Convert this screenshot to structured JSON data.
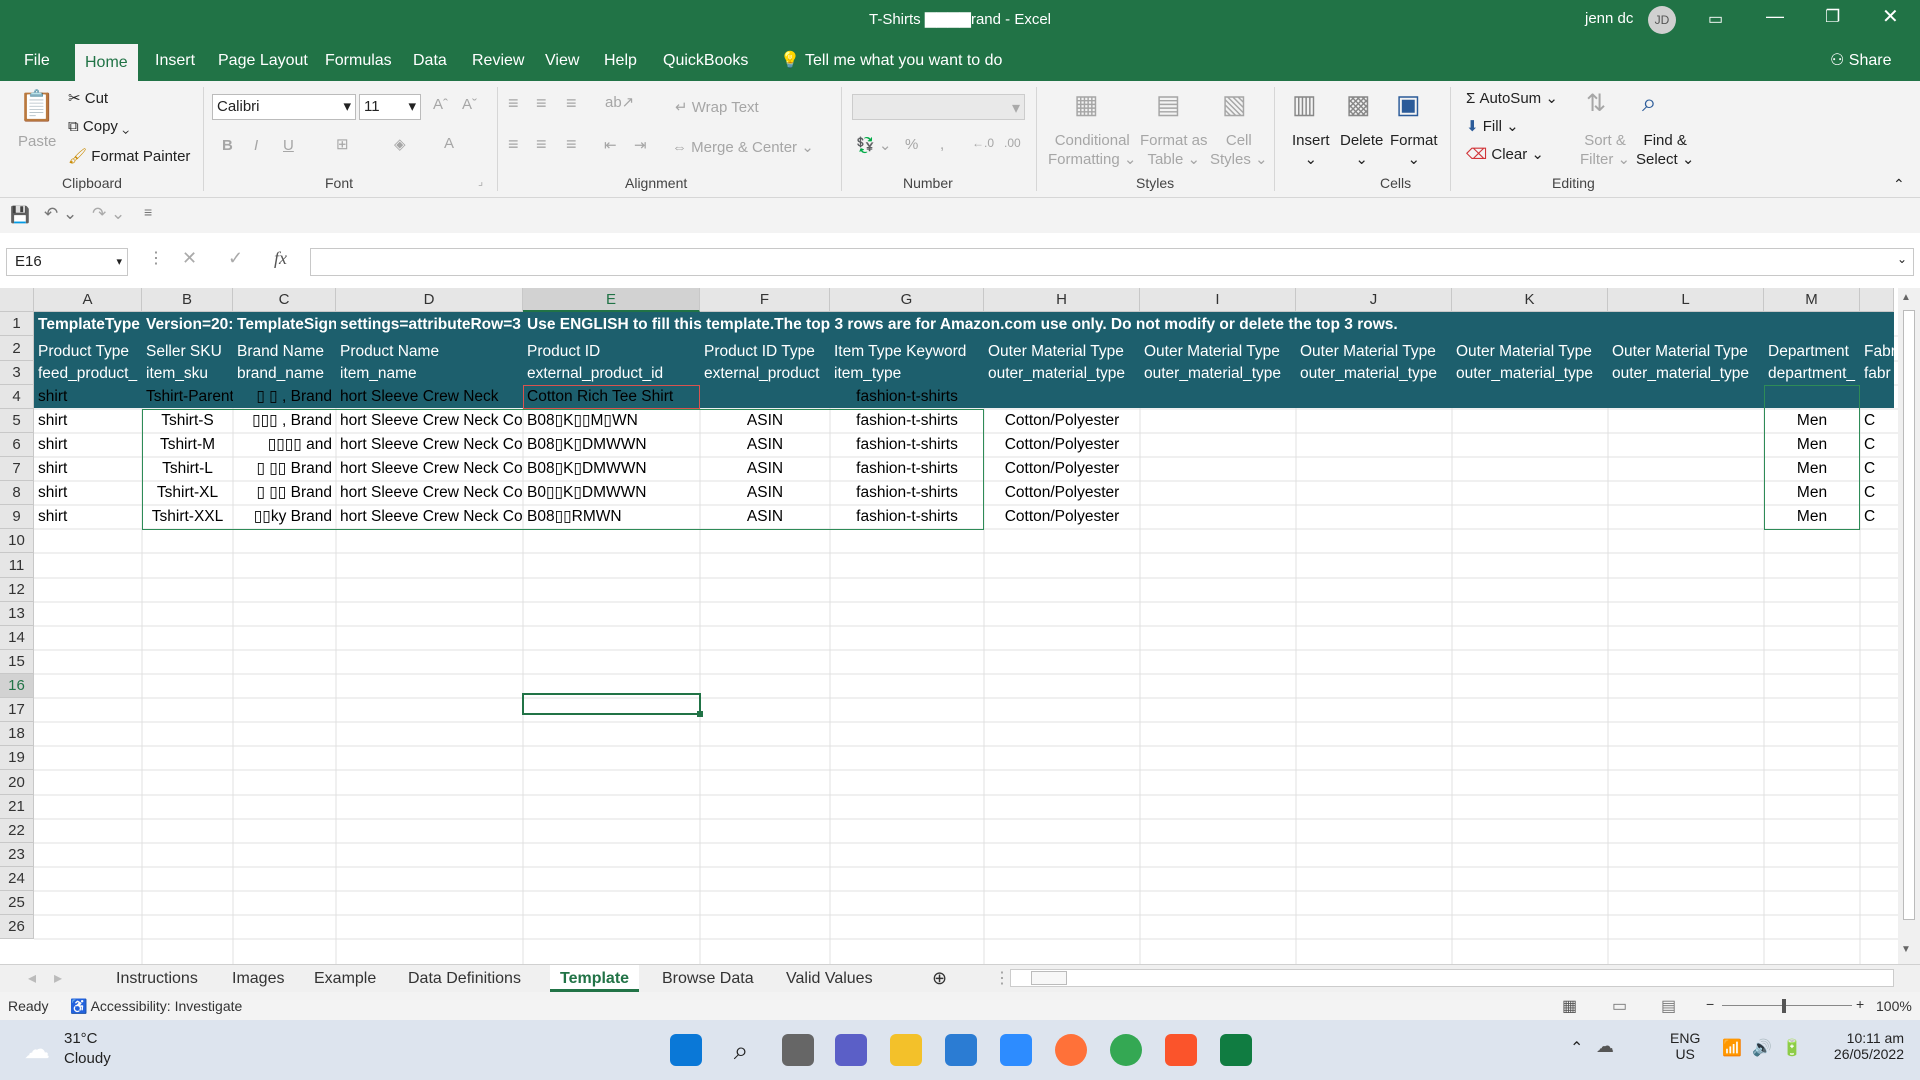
{
  "window": {
    "title": "T-Shirts ▇▇▇▇rand  -  Excel",
    "user": "jenn dc",
    "user_initials": "JD"
  },
  "ribbon_tabs": [
    "File",
    "Home",
    "Insert",
    "Page Layout",
    "Formulas",
    "Data",
    "Review",
    "View",
    "Help",
    "QuickBooks"
  ],
  "tell_me": "Tell me what you want to do",
  "share": "Share",
  "clipboard": {
    "paste": "Paste",
    "cut": "Cut",
    "copy": "Copy",
    "format_painter": "Format Painter",
    "label": "Clipboard"
  },
  "font": {
    "name": "Calibri",
    "size": "11",
    "label": "Font"
  },
  "alignment": {
    "wrap": "Wrap Text",
    "merge": "Merge & Center",
    "label": "Alignment"
  },
  "number": {
    "label": "Number"
  },
  "styles": {
    "conditional": "Conditional",
    "formatting": "Formatting",
    "format_as": "Format as",
    "table": "Table",
    "cell": "Cell",
    "cstyles": "Styles",
    "label": "Styles"
  },
  "cells": {
    "insert": "Insert",
    "delete": "Delete",
    "format": "Format",
    "label": "Cells"
  },
  "editing": {
    "autosum": "AutoSum",
    "fill": "Fill",
    "clear": "Clear",
    "sort": "Sort &",
    "filter": "Filter",
    "find": "Find &",
    "select": "Select",
    "label": "Editing"
  },
  "name_box": "E16",
  "fx": "fx",
  "columns": [
    "A",
    "B",
    "C",
    "D",
    "E",
    "F",
    "G",
    "H",
    "I",
    "J",
    "K",
    "L",
    "M"
  ],
  "rows": {
    "r1": "TemplateType",
    "r1b": "Version=20:",
    "r1c": "TemplateSign",
    "r1d": "settings=attributeRow=3",
    "r1e": "Use ENGLISH to fill this template.The top 3 rows are for Amazon.com use only. Do not modify or delete the top 3 rows.",
    "r2": [
      "Product Type",
      "Seller SKU",
      "Brand Name",
      "Product Name",
      "Product ID",
      "Product ID Type",
      "Item Type Keyword",
      "Outer Material Type",
      "Outer Material Type",
      "Outer Material Type",
      "Outer Material Type",
      "Outer Material Type",
      "Department",
      "Fabr"
    ],
    "r3": [
      "feed_product_",
      "item_sku",
      "brand_name",
      "item_name",
      "external_product_id",
      "external_product",
      "item_type",
      "outer_material_type",
      "outer_material_type",
      "outer_material_type",
      "outer_material_type",
      "outer_material_type",
      "department_",
      "fabr"
    ],
    "data": [
      [
        "shirt",
        "Tshirt-Parent",
        "▯ ▯ , Brand",
        "hort Sleeve Crew Neck",
        "Cotton Rich Tee Shirt",
        "",
        "fashion-t-shirts",
        "",
        "",
        "",
        ""
      ],
      [
        "shirt",
        "Tshirt-S",
        "▯▯▯ , Brand",
        "hort Sleeve Crew Neck Co",
        "B08▯K▯▯M▯WN",
        "ASIN",
        "fashion-t-shirts",
        "Cotton/Polyester",
        "Men",
        "C"
      ],
      [
        "shirt",
        "Tshirt-M",
        "▯▯▯▯ and",
        "hort Sleeve Crew Neck Co",
        "B08▯K▯DMWWN",
        "ASIN",
        "fashion-t-shirts",
        "Cotton/Polyester",
        "Men",
        "C"
      ],
      [
        "shirt",
        "Tshirt-L",
        "▯ ▯▯ Brand",
        "hort Sleeve Crew Neck Co",
        "B08▯K▯DMWWN",
        "ASIN",
        "fashion-t-shirts",
        "Cotton/Polyester",
        "Men",
        "C"
      ],
      [
        "shirt",
        "Tshirt-XL",
        "▯ ▯▯ Brand",
        "hort Sleeve Crew Neck Co",
        "B0▯▯K▯DMWWN",
        "ASIN",
        "fashion-t-shirts",
        "Cotton/Polyester",
        "Men",
        "C"
      ],
      [
        "shirt",
        "Tshirt-XXL",
        "▯▯ky Brand",
        "hort Sleeve Crew Neck Co",
        "B08▯▯RMWN",
        "ASIN",
        "fashion-t-shirts",
        "Cotton/Polyester",
        "Men",
        "C"
      ]
    ],
    "numbers": [
      "1",
      "2",
      "3",
      "4",
      "5",
      "6",
      "7",
      "8",
      "9",
      "10",
      "11",
      "12",
      "13",
      "14",
      "15",
      "16",
      "17",
      "18",
      "19",
      "20",
      "21",
      "22",
      "23",
      "24",
      "25",
      "26"
    ]
  },
  "sheet_tabs": [
    "Instructions",
    "Images",
    "Example",
    "Data Definitions",
    "Template",
    "Browse Data",
    "Valid Values"
  ],
  "status": {
    "ready": "Ready",
    "accessibility": "Accessibility: Investigate",
    "zoom": "100%"
  },
  "taskbar": {
    "temp": "31°C",
    "weather": "Cloudy",
    "lang1": "ENG",
    "lang2": "US",
    "time": "10:11 am",
    "date": "26/05/2022"
  },
  "colors": {
    "excel_green": "#217346",
    "header_teal": "#1d5f6d"
  }
}
